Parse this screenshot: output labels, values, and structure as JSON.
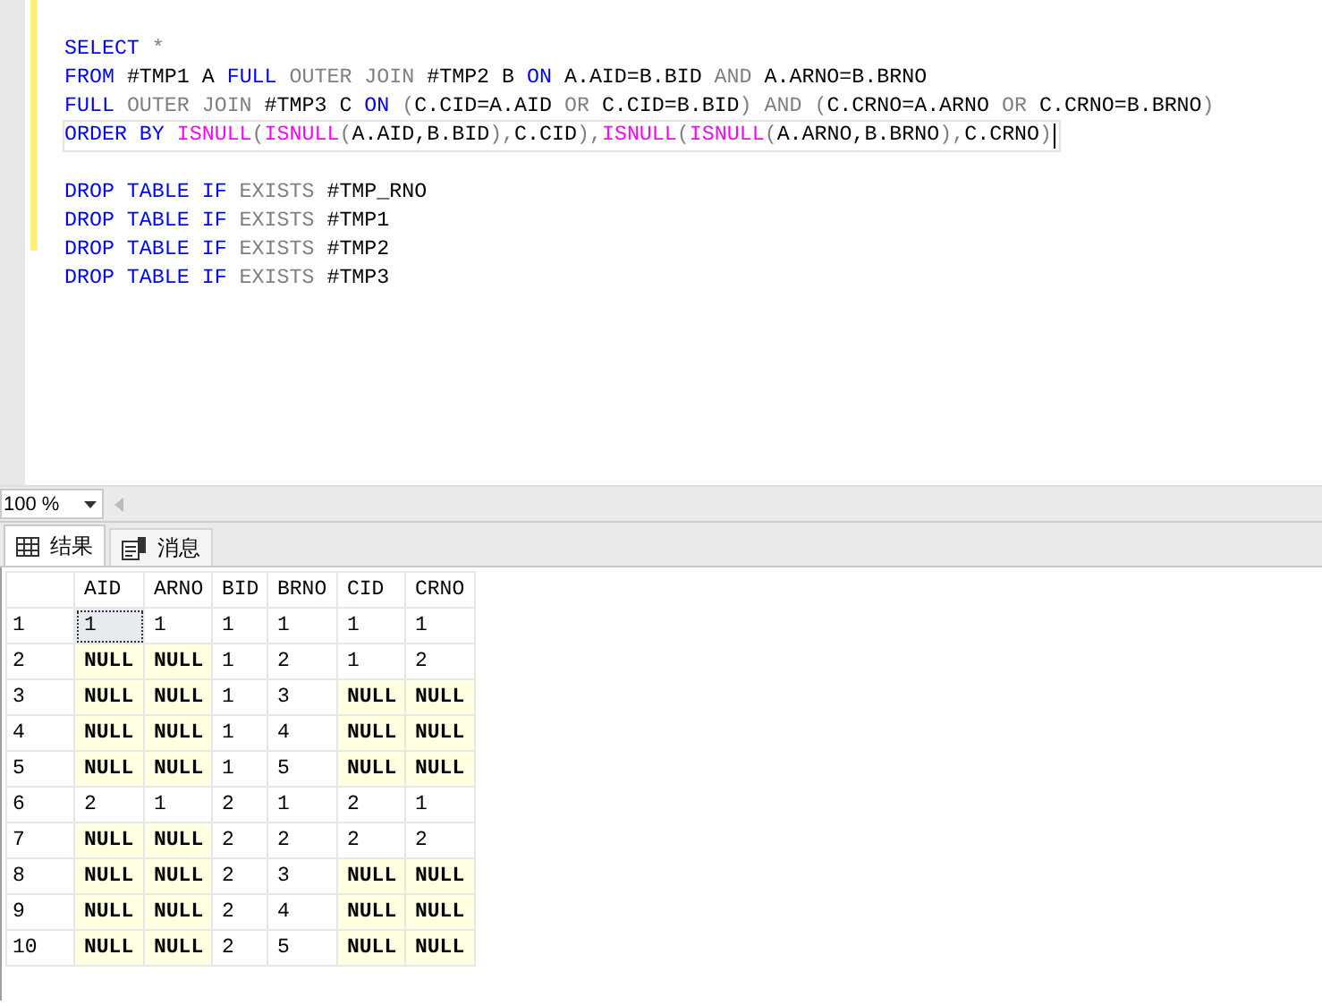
{
  "editor": {
    "blocks": [
      [
        {
          "current": false,
          "tokens": [
            {
              "t": "SELECT",
              "kind": "keyword"
            },
            {
              "t": " *",
              "kind": "operator"
            }
          ]
        },
        {
          "current": false,
          "tokens": [
            {
              "t": "FROM",
              "kind": "keyword"
            },
            {
              "t": " #TMP1 A ",
              "kind": "identifier"
            },
            {
              "t": "FULL",
              "kind": "keyword"
            },
            {
              "t": " OUTER JOIN",
              "kind": "operator"
            },
            {
              "t": " #TMP2 B ",
              "kind": "identifier"
            },
            {
              "t": "ON",
              "kind": "keyword"
            },
            {
              "t": " A.AID=B.BID ",
              "kind": "identifier"
            },
            {
              "t": "AND",
              "kind": "operator"
            },
            {
              "t": " A.ARNO=B.BRNO",
              "kind": "identifier"
            }
          ]
        },
        {
          "current": false,
          "tokens": [
            {
              "t": "FULL",
              "kind": "keyword"
            },
            {
              "t": " OUTER JOIN",
              "kind": "operator"
            },
            {
              "t": " #TMP3 C ",
              "kind": "identifier"
            },
            {
              "t": "ON",
              "kind": "keyword"
            },
            {
              "t": " (",
              "kind": "operator"
            },
            {
              "t": "C.CID=A.AID ",
              "kind": "identifier"
            },
            {
              "t": "OR",
              "kind": "operator"
            },
            {
              "t": " C.CID=B.BID",
              "kind": "identifier"
            },
            {
              "t": ") AND (",
              "kind": "operator"
            },
            {
              "t": "C.CRNO=A.ARNO ",
              "kind": "identifier"
            },
            {
              "t": "OR",
              "kind": "operator"
            },
            {
              "t": " C.CRNO=B.BRNO",
              "kind": "identifier"
            },
            {
              "t": ")",
              "kind": "operator"
            }
          ]
        },
        {
          "current": true,
          "tokens": [
            {
              "t": "ORDER BY ",
              "kind": "keyword"
            },
            {
              "t": "ISNULL",
              "kind": "function"
            },
            {
              "t": "(",
              "kind": "operator"
            },
            {
              "t": "ISNULL",
              "kind": "function"
            },
            {
              "t": "(",
              "kind": "operator"
            },
            {
              "t": "A.AID,B.BID",
              "kind": "identifier"
            },
            {
              "t": "),",
              "kind": "operator"
            },
            {
              "t": "C.CID",
              "kind": "identifier"
            },
            {
              "t": "),",
              "kind": "operator"
            },
            {
              "t": "ISNULL",
              "kind": "function"
            },
            {
              "t": "(",
              "kind": "operator"
            },
            {
              "t": "ISNULL",
              "kind": "function"
            },
            {
              "t": "(",
              "kind": "operator"
            },
            {
              "t": "A.ARNO,B.BRNO",
              "kind": "identifier"
            },
            {
              "t": "),",
              "kind": "operator"
            },
            {
              "t": "C.CRNO",
              "kind": "identifier"
            },
            {
              "t": ")",
              "kind": "operator"
            }
          ]
        }
      ],
      [
        {
          "current": false,
          "tokens": [
            {
              "t": "DROP TABLE IF",
              "kind": "keyword"
            },
            {
              "t": " EXISTS",
              "kind": "operator"
            },
            {
              "t": " #TMP_RNO",
              "kind": "identifier"
            }
          ]
        },
        {
          "current": false,
          "tokens": [
            {
              "t": "DROP TABLE IF",
              "kind": "keyword"
            },
            {
              "t": " EXISTS",
              "kind": "operator"
            },
            {
              "t": " #TMP1",
              "kind": "identifier"
            }
          ]
        },
        {
          "current": false,
          "tokens": [
            {
              "t": "DROP TABLE IF",
              "kind": "keyword"
            },
            {
              "t": " EXISTS",
              "kind": "operator"
            },
            {
              "t": " #TMP2",
              "kind": "identifier"
            }
          ]
        },
        {
          "current": false,
          "tokens": [
            {
              "t": "DROP TABLE IF",
              "kind": "keyword"
            },
            {
              "t": " EXISTS",
              "kind": "operator"
            },
            {
              "t": " #TMP3",
              "kind": "identifier"
            }
          ]
        }
      ]
    ]
  },
  "zoom": {
    "value": "100 %"
  },
  "tabs": [
    {
      "label": "结果",
      "kind": "grid",
      "selected": true
    },
    {
      "label": "消息",
      "kind": "messages",
      "selected": false
    }
  ],
  "grid": {
    "columns": [
      "AID",
      "ARNO",
      "BID",
      "BRNO",
      "CID",
      "CRNO"
    ],
    "rows": [
      {
        "number": "1",
        "cells": [
          {
            "v": "1",
            "null": false,
            "selected": true
          },
          {
            "v": "1",
            "null": false,
            "selected": false
          },
          {
            "v": "1",
            "null": false,
            "selected": false
          },
          {
            "v": "1",
            "null": false,
            "selected": false
          },
          {
            "v": "1",
            "null": false,
            "selected": false
          },
          {
            "v": "1",
            "null": false,
            "selected": false
          }
        ]
      },
      {
        "number": "2",
        "cells": [
          {
            "v": "NULL",
            "null": true,
            "selected": false
          },
          {
            "v": "NULL",
            "null": true,
            "selected": false
          },
          {
            "v": "1",
            "null": false,
            "selected": false
          },
          {
            "v": "2",
            "null": false,
            "selected": false
          },
          {
            "v": "1",
            "null": false,
            "selected": false
          },
          {
            "v": "2",
            "null": false,
            "selected": false
          }
        ]
      },
      {
        "number": "3",
        "cells": [
          {
            "v": "NULL",
            "null": true,
            "selected": false
          },
          {
            "v": "NULL",
            "null": true,
            "selected": false
          },
          {
            "v": "1",
            "null": false,
            "selected": false
          },
          {
            "v": "3",
            "null": false,
            "selected": false
          },
          {
            "v": "NULL",
            "null": true,
            "selected": false
          },
          {
            "v": "NULL",
            "null": true,
            "selected": false
          }
        ]
      },
      {
        "number": "4",
        "cells": [
          {
            "v": "NULL",
            "null": true,
            "selected": false
          },
          {
            "v": "NULL",
            "null": true,
            "selected": false
          },
          {
            "v": "1",
            "null": false,
            "selected": false
          },
          {
            "v": "4",
            "null": false,
            "selected": false
          },
          {
            "v": "NULL",
            "null": true,
            "selected": false
          },
          {
            "v": "NULL",
            "null": true,
            "selected": false
          }
        ]
      },
      {
        "number": "5",
        "cells": [
          {
            "v": "NULL",
            "null": true,
            "selected": false
          },
          {
            "v": "NULL",
            "null": true,
            "selected": false
          },
          {
            "v": "1",
            "null": false,
            "selected": false
          },
          {
            "v": "5",
            "null": false,
            "selected": false
          },
          {
            "v": "NULL",
            "null": true,
            "selected": false
          },
          {
            "v": "NULL",
            "null": true,
            "selected": false
          }
        ]
      },
      {
        "number": "6",
        "cells": [
          {
            "v": "2",
            "null": false,
            "selected": false
          },
          {
            "v": "1",
            "null": false,
            "selected": false
          },
          {
            "v": "2",
            "null": false,
            "selected": false
          },
          {
            "v": "1",
            "null": false,
            "selected": false
          },
          {
            "v": "2",
            "null": false,
            "selected": false
          },
          {
            "v": "1",
            "null": false,
            "selected": false
          }
        ]
      },
      {
        "number": "7",
        "cells": [
          {
            "v": "NULL",
            "null": true,
            "selected": false
          },
          {
            "v": "NULL",
            "null": true,
            "selected": false
          },
          {
            "v": "2",
            "null": false,
            "selected": false
          },
          {
            "v": "2",
            "null": false,
            "selected": false
          },
          {
            "v": "2",
            "null": false,
            "selected": false
          },
          {
            "v": "2",
            "null": false,
            "selected": false
          }
        ]
      },
      {
        "number": "8",
        "cells": [
          {
            "v": "NULL",
            "null": true,
            "selected": false
          },
          {
            "v": "NULL",
            "null": true,
            "selected": false
          },
          {
            "v": "2",
            "null": false,
            "selected": false
          },
          {
            "v": "3",
            "null": false,
            "selected": false
          },
          {
            "v": "NULL",
            "null": true,
            "selected": false
          },
          {
            "v": "NULL",
            "null": true,
            "selected": false
          }
        ]
      },
      {
        "number": "9",
        "cells": [
          {
            "v": "NULL",
            "null": true,
            "selected": false
          },
          {
            "v": "NULL",
            "null": true,
            "selected": false
          },
          {
            "v": "2",
            "null": false,
            "selected": false
          },
          {
            "v": "4",
            "null": false,
            "selected": false
          },
          {
            "v": "NULL",
            "null": true,
            "selected": false
          },
          {
            "v": "NULL",
            "null": true,
            "selected": false
          }
        ]
      },
      {
        "number": "10",
        "cells": [
          {
            "v": "NULL",
            "null": true,
            "selected": false
          },
          {
            "v": "NULL",
            "null": true,
            "selected": false
          },
          {
            "v": "2",
            "null": false,
            "selected": false
          },
          {
            "v": "5",
            "null": false,
            "selected": false
          },
          {
            "v": "NULL",
            "null": true,
            "selected": false
          },
          {
            "v": "NULL",
            "null": true,
            "selected": false
          }
        ]
      }
    ]
  }
}
